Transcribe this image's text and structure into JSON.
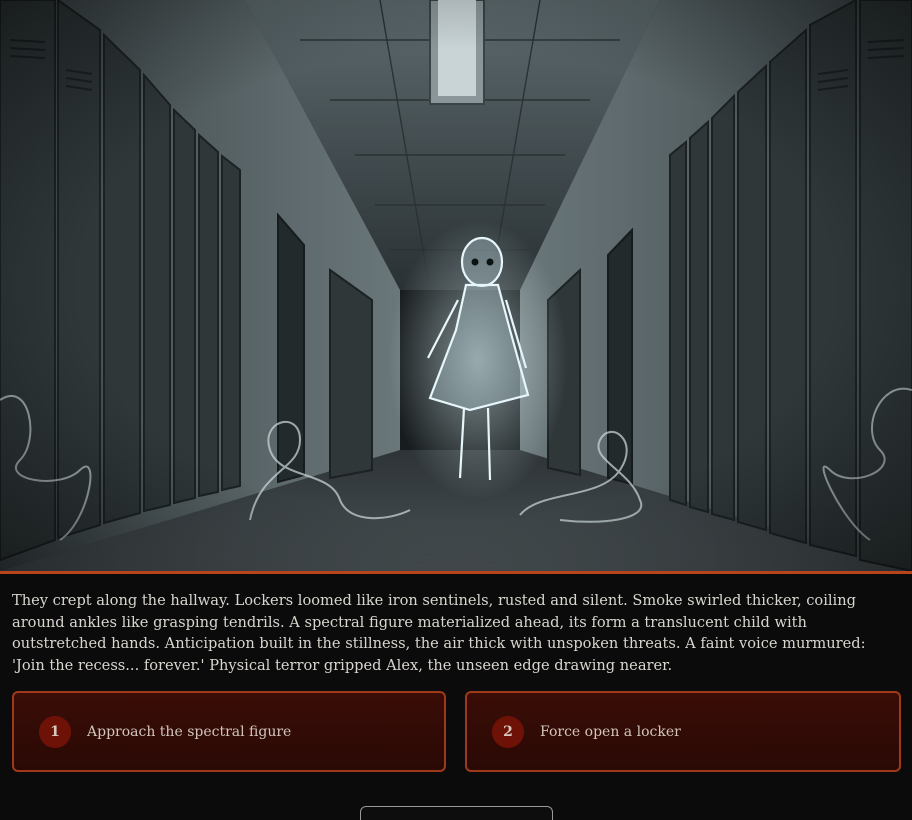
{
  "scene": {
    "image_alt": "Ghostly translucent child floating down a school hallway lined with lockers, smoke curling on the floor"
  },
  "story": {
    "text": "They crept along the hallway. Lockers loomed like iron sentinels, rusted and silent. Smoke swirled thicker, coiling around ankles like grasping tendrils. A spectral figure materialized ahead, its form a translucent child with outstretched hands. Anticipation built in the stillness, the air thick with unspoken threats. A faint voice murmured: 'Join the recess... forever.' Physical terror gripped Alex, the unseen edge drawing nearer."
  },
  "choices": [
    {
      "number": "1",
      "label": "Approach the spectral figure"
    },
    {
      "number": "2",
      "label": "Force open a locker"
    }
  ],
  "colors": {
    "accent": "#b8441c",
    "choice_bg": "#2a0905",
    "badge": "#6e1208"
  }
}
